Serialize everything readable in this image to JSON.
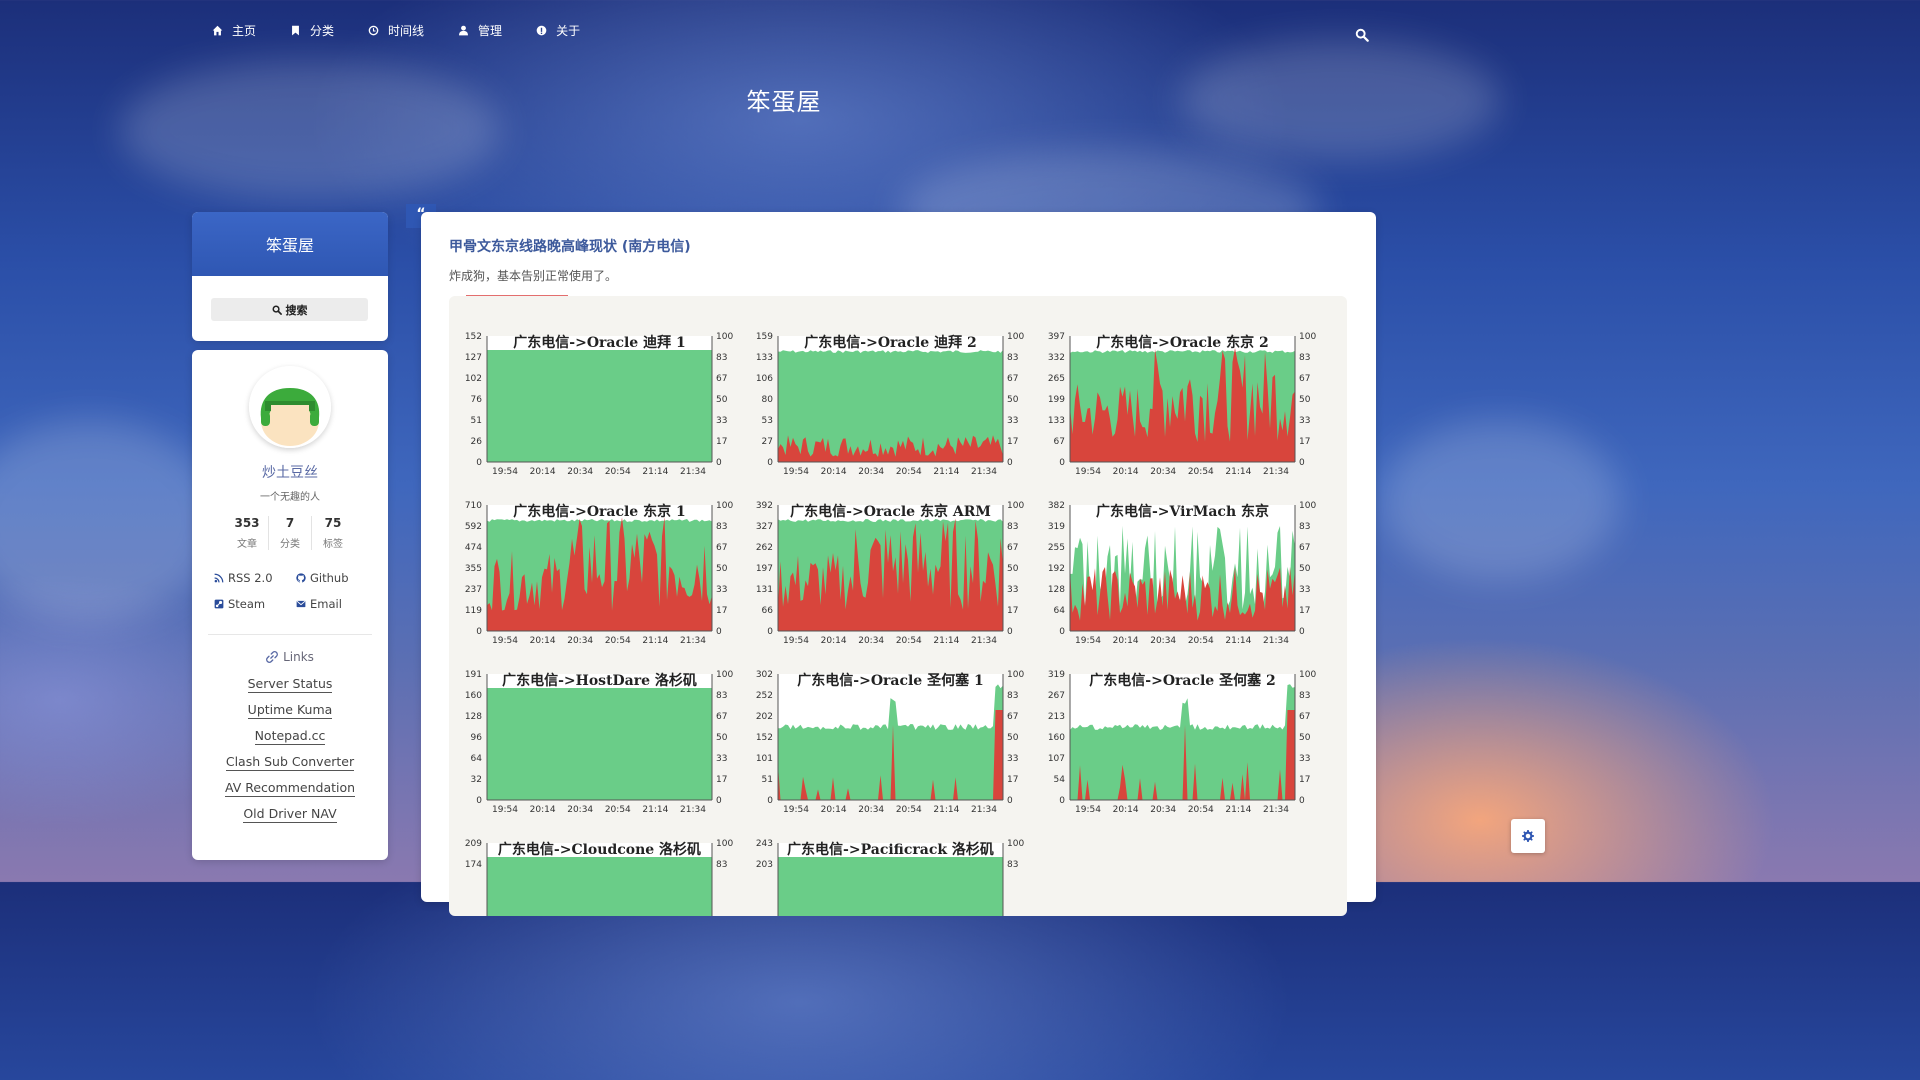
{
  "nav": {
    "items": [
      {
        "label": "主页",
        "icon": "home-icon"
      },
      {
        "label": "分类",
        "icon": "bookmark-icon"
      },
      {
        "label": "时间线",
        "icon": "clock-icon"
      },
      {
        "label": "管理",
        "icon": "user-icon"
      },
      {
        "label": "关于",
        "icon": "info-icon"
      }
    ],
    "search_icon": "search-icon"
  },
  "site": {
    "title": "笨蛋屋"
  },
  "sidebar": {
    "brand": "笨蛋屋",
    "search_label": "搜索",
    "author": "炒土豆丝",
    "motto": "一个无趣的人",
    "stats": [
      {
        "num": "353",
        "label": "文章"
      },
      {
        "num": "7",
        "label": "分类"
      },
      {
        "num": "75",
        "label": "标签"
      }
    ],
    "social": [
      {
        "label": "RSS 2.0",
        "icon": "rss-icon"
      },
      {
        "label": "Github",
        "icon": "github-icon"
      },
      {
        "label": "Steam",
        "icon": "steam-icon"
      },
      {
        "label": "Email",
        "icon": "envelope-icon"
      }
    ],
    "links_title": "Links",
    "links": [
      "Server Status",
      "Uptime Kuma",
      "Notepad.cc",
      "Clash Sub Converter",
      "AV Recommendation",
      "Old Driver NAV"
    ]
  },
  "post": {
    "quote_mark": "“",
    "title": "甲骨文东京线路晚高峰现状 (南方电信)",
    "subtitle": "炸成狗，基本告别正常使用了。"
  },
  "colors": {
    "ok": "#6acd88",
    "loss": "#d8453c",
    "accent": "#2f57b3"
  },
  "chart_data": [
    {
      "type": "area",
      "title": "广东电信->Oracle 迪拜 1",
      "yticks": [
        "152",
        "127",
        "102",
        "76",
        "51",
        "26",
        "0"
      ],
      "ytick_right": [
        "100",
        "83",
        "67",
        "50",
        "33",
        "17",
        "0"
      ],
      "x": [
        "19:54",
        "20:14",
        "20:34",
        "20:54",
        "21:14",
        "21:34"
      ],
      "pattern": "flat"
    },
    {
      "type": "area",
      "title": "广东电信->Oracle 迪拜 2",
      "yticks": [
        "159",
        "133",
        "106",
        "80",
        "53",
        "27",
        "0"
      ],
      "ytick_right": [
        "100",
        "83",
        "67",
        "50",
        "33",
        "17",
        "0"
      ],
      "x": [
        "19:54",
        "20:14",
        "20:34",
        "20:54",
        "21:14",
        "21:34"
      ],
      "pattern": "low-loss"
    },
    {
      "type": "area",
      "title": "广东电信->Oracle 东京 2",
      "yticks": [
        "397",
        "332",
        "265",
        "199",
        "133",
        "67",
        "0"
      ],
      "ytick_right": [
        "100",
        "83",
        "67",
        "50",
        "33",
        "17",
        "0"
      ],
      "x": [
        "19:54",
        "20:14",
        "20:34",
        "20:54",
        "21:14",
        "21:34"
      ],
      "pattern": "heavy-loss"
    },
    {
      "type": "area",
      "title": "广东电信->Oracle 东京 1",
      "yticks": [
        "710",
        "592",
        "474",
        "355",
        "237",
        "119",
        "0"
      ],
      "ytick_right": [
        "100",
        "83",
        "67",
        "50",
        "33",
        "17",
        "0"
      ],
      "x": [
        "19:54",
        "20:14",
        "20:34",
        "20:54",
        "21:14",
        "21:34"
      ],
      "pattern": "heavy-loss"
    },
    {
      "type": "area",
      "title": "广东电信->Oracle 东京 ARM",
      "yticks": [
        "392",
        "327",
        "262",
        "197",
        "131",
        "66",
        "0"
      ],
      "ytick_right": [
        "100",
        "83",
        "67",
        "50",
        "33",
        "17",
        "0"
      ],
      "x": [
        "19:54",
        "20:14",
        "20:34",
        "20:54",
        "21:14",
        "21:34"
      ],
      "pattern": "heavy-loss"
    },
    {
      "type": "area",
      "title": "广东电信->VirMach 东京",
      "yticks": [
        "382",
        "319",
        "255",
        "192",
        "128",
        "64",
        "0"
      ],
      "ytick_right": [
        "100",
        "83",
        "67",
        "50",
        "33",
        "17",
        "0"
      ],
      "x": [
        "19:54",
        "20:14",
        "20:34",
        "20:54",
        "21:14",
        "21:34"
      ],
      "pattern": "spiky"
    },
    {
      "type": "area",
      "title": "广东电信->HostDare 洛杉矶",
      "yticks": [
        "191",
        "160",
        "128",
        "96",
        "64",
        "32",
        "0"
      ],
      "ytick_right": [
        "100",
        "83",
        "67",
        "50",
        "33",
        "17",
        "0"
      ],
      "x": [
        "19:54",
        "20:14",
        "20:34",
        "20:54",
        "21:14",
        "21:34"
      ],
      "pattern": "flat"
    },
    {
      "type": "area",
      "title": "广东电信->Oracle 圣何塞 1",
      "yticks": [
        "302",
        "252",
        "202",
        "152",
        "101",
        "51",
        "0"
      ],
      "ytick_right": [
        "100",
        "83",
        "67",
        "50",
        "33",
        "17",
        "0"
      ],
      "x": [
        "19:54",
        "20:14",
        "20:34",
        "20:54",
        "21:14",
        "21:34"
      ],
      "pattern": "mid-spike"
    },
    {
      "type": "area",
      "title": "广东电信->Oracle 圣何塞 2",
      "yticks": [
        "319",
        "267",
        "213",
        "160",
        "107",
        "54",
        "0"
      ],
      "ytick_right": [
        "100",
        "83",
        "67",
        "50",
        "33",
        "17",
        "0"
      ],
      "x": [
        "19:54",
        "20:14",
        "20:34",
        "20:54",
        "21:14",
        "21:34"
      ],
      "pattern": "mid-spike"
    },
    {
      "type": "area",
      "title": "广东电信->Cloudcone 洛杉矶",
      "yticks": [
        "209",
        "174"
      ],
      "ytick_right": [
        "100",
        "83"
      ],
      "x": [],
      "pattern": "flat"
    },
    {
      "type": "area",
      "title": "广东电信->Pacificrack 洛杉矶",
      "yticks": [
        "243",
        "203"
      ],
      "ytick_right": [
        "100",
        "83"
      ],
      "x": [],
      "pattern": "flat"
    }
  ]
}
